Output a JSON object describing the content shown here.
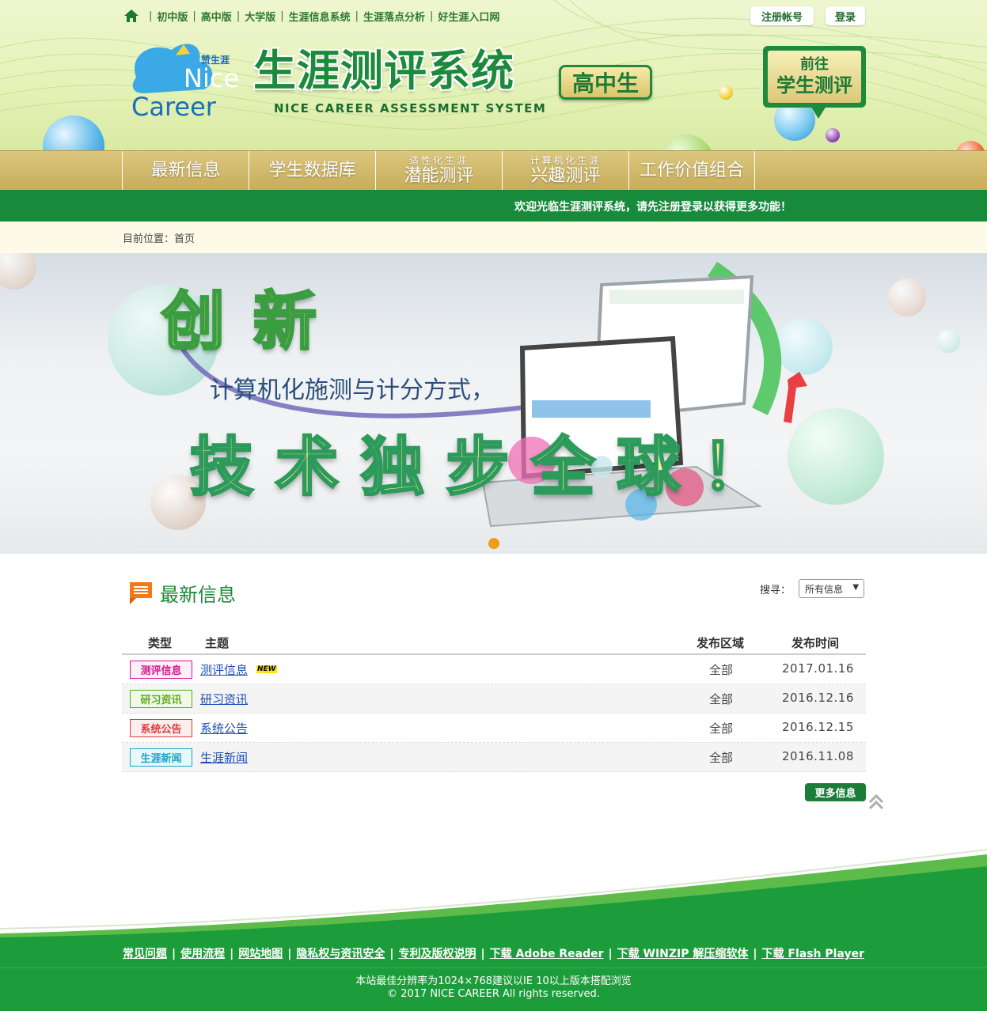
{
  "header": {
    "top_links": [
      "初中版",
      "高中版",
      "大学版",
      "生涯信息系统",
      "生涯落点分析",
      "好生涯入口网"
    ],
    "register_label": "注册帐号",
    "login_label": "登录",
    "logo": {
      "cn": "赞生涯",
      "line1": "Nice",
      "line2": "Career"
    },
    "system_title": "生涯测评系统",
    "system_subtitle": "NICE CAREER ASSESSMENT SYSTEM",
    "grade_badge": "高中生",
    "go_test": {
      "line1": "前往",
      "line2": "学生测评"
    }
  },
  "nav": {
    "items": [
      {
        "small": "",
        "big": "最新信息"
      },
      {
        "small": "",
        "big": "学生数据库"
      },
      {
        "small": "适性化生涯",
        "big": "潜能测评"
      },
      {
        "small": "计算机化生涯",
        "big": "兴趣测评"
      },
      {
        "small": "",
        "big": "工作价值组合"
      }
    ]
  },
  "welcome_text": "欢迎光临生涯测评系统，请先注册登录以获得更多功能！",
  "breadcrumb": {
    "label": "目前位置：",
    "current": "首页"
  },
  "banner": {
    "line1": "创 新",
    "line2": "计算机化施测与计分方式，",
    "line3": "技 术 独 步 全 球 ！",
    "active_slide": 1
  },
  "news": {
    "title": "最新信息",
    "search_label": "搜寻：",
    "search_selected": "所有信息",
    "columns": {
      "type": "类型",
      "subject": "主题",
      "area": "发布区域",
      "date": "发布时间"
    },
    "rows": [
      {
        "type": "测评信息",
        "subject": "测评信息",
        "is_new": true,
        "new_label": "NEW",
        "area": "全部",
        "date": "2017.01.16",
        "color": "#d6198f"
      },
      {
        "type": "研习资讯",
        "subject": "研习资讯",
        "is_new": false,
        "new_label": "",
        "area": "全部",
        "date": "2016.12.16",
        "color": "#5cab1e"
      },
      {
        "type": "系统公告",
        "subject": "系统公告",
        "is_new": false,
        "new_label": "",
        "area": "全部",
        "date": "2016.12.15",
        "color": "#e03a3a"
      },
      {
        "type": "生涯新闻",
        "subject": "生涯新闻",
        "is_new": false,
        "new_label": "",
        "area": "全部",
        "date": "2016.11.08",
        "color": "#1aa3c9"
      }
    ],
    "more_label": "更多信息"
  },
  "footer": {
    "links": [
      "常见问题",
      "使用流程",
      "网站地图",
      "隐私权与资讯安全",
      "专利及版权说明",
      "下载 Adobe Reader",
      "下载 WINZIP 解压缩软体",
      "下载 Flash Player"
    ],
    "resolution_note": "本站最佳分辨率为1024×768建议以IE 10以上版本搭配浏览",
    "copyright": "© 2017 NICE CAREER All rights reserved."
  },
  "colors": {
    "brand_green": "#178a3b",
    "nav_gold": "#c9b064",
    "footer_green": "#1d9c3b",
    "link_blue": "#1a4db3"
  }
}
